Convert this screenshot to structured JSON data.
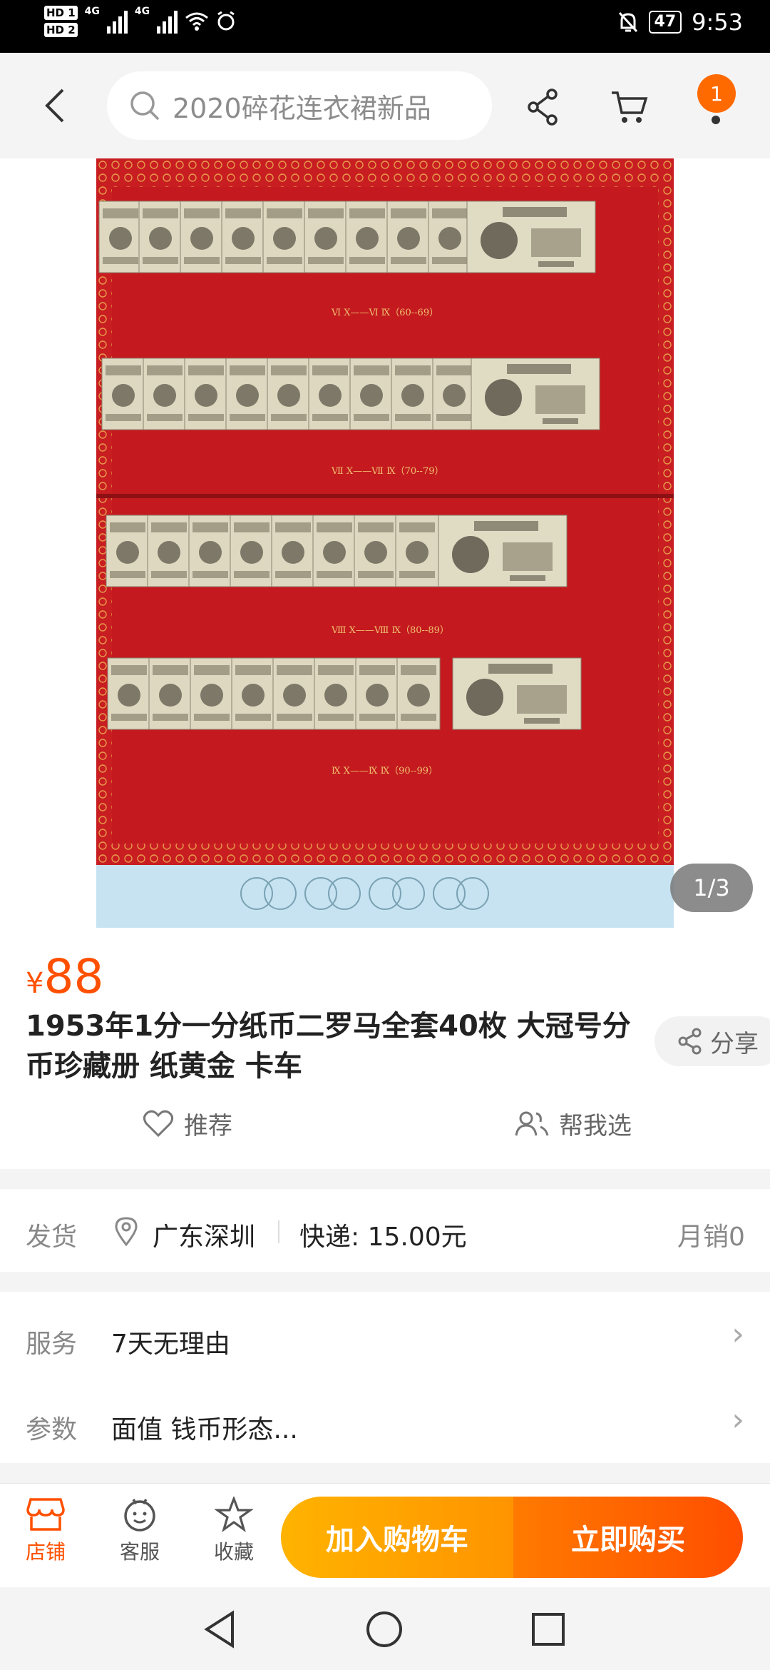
{
  "status_bar": {
    "hd1": "HD 1",
    "hd2": "HD 2",
    "net1": "4G",
    "net2": "4G",
    "battery": "47",
    "time": "9:53"
  },
  "search": {
    "placeholder": "2020碎花连衣裙新品",
    "cart_badge": "1"
  },
  "gallery": {
    "counter": "1/3",
    "row_captions": [
      "Ⅵ Ⅹ——Ⅵ Ⅸ（60--69）",
      "Ⅶ Ⅹ——Ⅶ Ⅸ（70--79）",
      "Ⅷ Ⅹ——Ⅷ Ⅸ（80--89）",
      "Ⅸ Ⅹ——Ⅸ Ⅸ（90--99）"
    ],
    "note_denomination": "壹分"
  },
  "product": {
    "currency": "¥",
    "price": "88",
    "title": "1953年1分一分纸币二罗马全套40枚 大冠号分币珍藏册 纸黄金 卡车",
    "share_label": "分享",
    "recommend_label": "推荐",
    "help_choose_label": "帮我选"
  },
  "shipping": {
    "label": "发货",
    "location": "广东深圳",
    "express": "快递: 15.00元",
    "monthly_sales": "月销0"
  },
  "service": {
    "label": "服务",
    "value": "7天无理由"
  },
  "params": {
    "label": "参数",
    "value": "面值 钱币形态..."
  },
  "bottom_bar": {
    "store_label": "店铺",
    "service_label": "客服",
    "favorite_label": "收藏",
    "add_to_cart": "加入购物车",
    "buy_now": "立即购买"
  },
  "colors": {
    "accent": "#ff5000",
    "cart_button": "#ffa300",
    "buy_button": "#ff5a00"
  }
}
